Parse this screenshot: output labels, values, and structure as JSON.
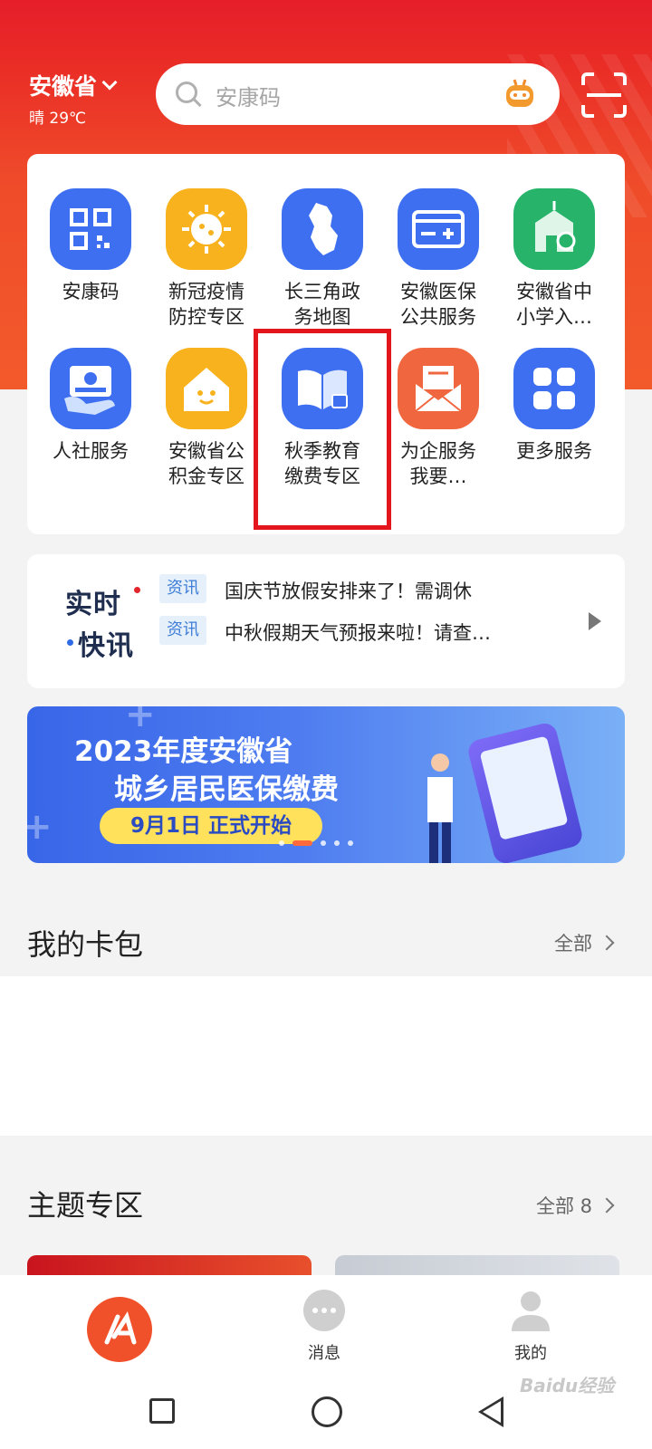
{
  "header": {
    "province": "安徽省",
    "weather": "晴 29℃",
    "search_placeholder": "安康码"
  },
  "services": [
    {
      "label": "安康码",
      "icon": "qr-code-icon",
      "color": "#3d6ff0"
    },
    {
      "label": "新冠疫情\n防控专区",
      "icon": "virus-icon",
      "color": "#f7b21e"
    },
    {
      "label": "长三角政\n务地图",
      "icon": "map-icon",
      "color": "#3d6ff0"
    },
    {
      "label": "安徽医保\n公共服务",
      "icon": "card-icon",
      "color": "#3d6ff0"
    },
    {
      "label": "安徽省中\n小学入…",
      "icon": "school-icon",
      "color": "#27b46a"
    },
    {
      "label": "人社服务",
      "icon": "social-security-card-icon",
      "color": "#3d6ff0"
    },
    {
      "label": "安徽省公\n积金专区",
      "icon": "house-icon",
      "color": "#f7b21e"
    },
    {
      "label": "秋季教育\n缴费专区",
      "icon": "book-icon",
      "color": "#3d6ff0"
    },
    {
      "label": "为企服务\n我要…",
      "icon": "envelope-icon",
      "color": "#f0673f"
    },
    {
      "label": "更多服务",
      "icon": "grid-icon",
      "color": "#3d6ff0"
    }
  ],
  "news": {
    "logo_top": "实时",
    "logo_bottom": "快讯",
    "items": [
      {
        "tag": "资讯",
        "text": "国庆节放假安排来了！需调休"
      },
      {
        "tag": "资讯",
        "text": "中秋假期天气预报来啦！请查…"
      }
    ]
  },
  "banner": {
    "line1": "2023年度安徽省",
    "line2": "城乡居民医保缴费",
    "pill": "9月1日  正式开始"
  },
  "wallet": {
    "title": "我的卡包",
    "more": "全部"
  },
  "theme": {
    "title": "主题专区",
    "more": "全部 8"
  },
  "tabbar": {
    "message": "消息",
    "mine": "我的"
  },
  "watermark": "Baidu经验"
}
